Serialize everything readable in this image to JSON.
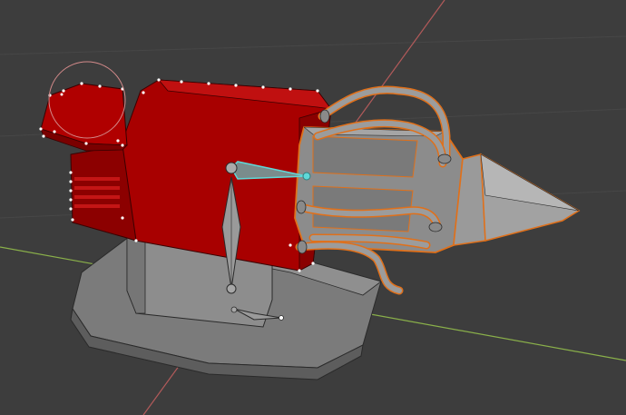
{
  "viewport": {
    "background_color": "#3d3d3d",
    "grid_color": "#474747",
    "x_axis_color": "#8ab04a",
    "y_axis_color": "#b25a5a"
  },
  "model": {
    "barrel_color": "#a80000",
    "barrel_dark_color": "#7a0000",
    "body_color": "#8a8a8a",
    "body_light_color": "#9a9a9a",
    "body_dark_color": "#6c6c6c",
    "selection_outline_color": "#e0701a",
    "vertex_color": "#ffffff"
  },
  "bones": {
    "active_bone_color": "#5fd8d8",
    "bone_color": "#a7a7a7"
  },
  "brush_cursor": {
    "color": "#d38a8a"
  }
}
